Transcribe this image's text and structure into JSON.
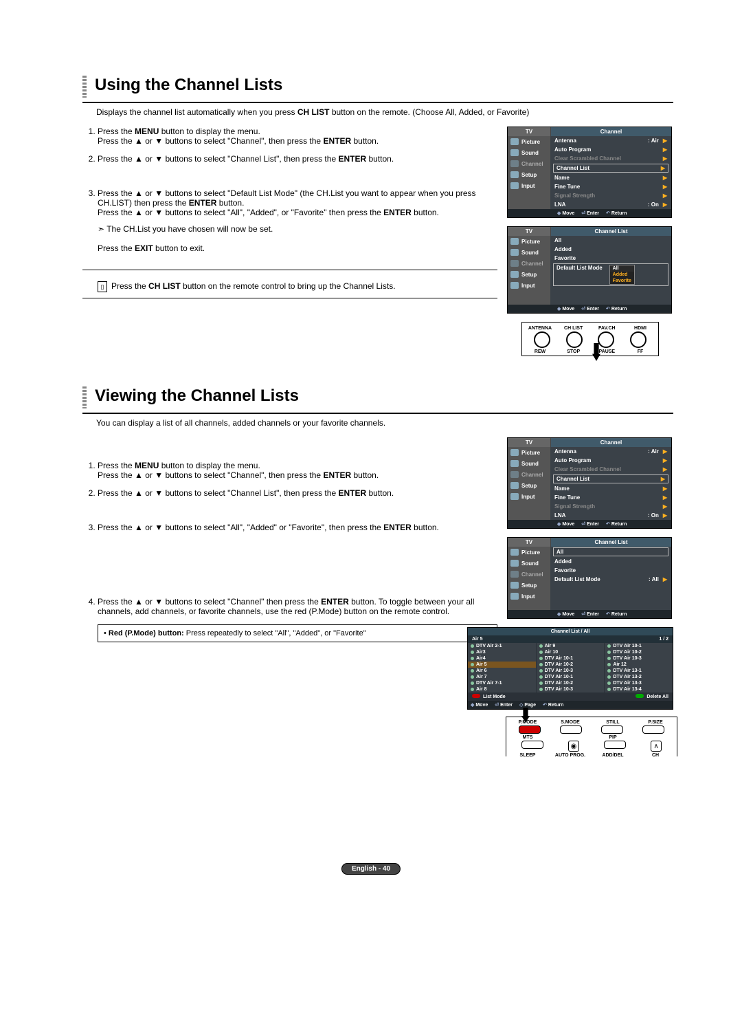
{
  "section1": {
    "title": "Using the Channel Lists",
    "intro_pre": "Displays the channel list automatically when you press ",
    "intro_key": "CH LIST",
    "intro_post": " button on the remote. (Choose All, Added, or Favorite)",
    "step1_a": "Press the ",
    "step1_key1": "MENU",
    "step1_b": " button to display the menu.",
    "step1_c": "Press the ▲ or ▼ buttons to select \"Channel\", then press the ",
    "step1_key2": "ENTER",
    "step1_d": " button.",
    "step2_a": "Press the ▲ or ▼ buttons to select \"Channel List\", then press the ",
    "step2_key": "ENTER",
    "step2_b": " button.",
    "step3_a": "Press the ▲ or ▼ buttons to select \"Default List Mode\" (the CH.List you want to appear when you press CH.LIST) then press the ",
    "step3_key1": "ENTER",
    "step3_b": " button.",
    "step3_c": "Press the ▲ or ▼ buttons to select \"All\", \"Added\", or \"Favorite\" then press the ",
    "step3_key2": "ENTER",
    "step3_d": " button.",
    "step3_note_icon": "➣",
    "step3_note": "The CH.List you have chosen will now be set.",
    "step3_exit_a": "Press the ",
    "step3_exit_key": "EXIT",
    "step3_exit_b": " button to exit.",
    "remote_note_a": "Press the ",
    "remote_note_key": "CH LIST",
    "remote_note_b": " button on the remote control to bring up the Channel Lists."
  },
  "section2": {
    "title": "Viewing the Channel Lists",
    "intro": "You can display a list of all channels, added channels or your favorite channels.",
    "step1_a": "Press the ",
    "step1_key1": "MENU",
    "step1_b": " button to display the menu.",
    "step1_c": "Press the ▲ or ▼ buttons to select \"Channel\", then press the ",
    "step1_key2": "ENTER",
    "step1_d": " button.",
    "step2_a": "Press the ▲ or ▼ buttons to select \"Channel List\", then press the ",
    "step2_key": "ENTER",
    "step2_b": " button.",
    "step3_a": "Press the ▲ or ▼ buttons to select \"All\", \"Added\" or \"Favorite\", then press the ",
    "step3_key": "ENTER",
    "step3_b": " button.",
    "step4_a": "Press the ▲ or ▼ buttons to select \"Channel\" then press the ",
    "step4_key": "ENTER",
    "step4_b": " button. To toggle between your all channels, add channels, or favorite channels, use the red (P.Mode) button on the remote control.",
    "callout_bullet": "•",
    "callout_key": "Red (P.Mode) button:",
    "callout_text": " Press repeatedly to select \"All\", \"Added\", or \"Favorite\""
  },
  "osd": {
    "tv": "TV",
    "channel_title": "Channel",
    "channel_list_title": "Channel List",
    "side": {
      "picture": "Picture",
      "sound": "Sound",
      "channel": "Channel",
      "setup": "Setup",
      "input": "Input"
    },
    "rows": {
      "antenna": "Antenna",
      "antenna_val": ": Air",
      "auto_program": "Auto Program",
      "clear_scrambled": "Clear Scrambled Channel",
      "channel_list": "Channel List",
      "name": "Name",
      "fine_tune": "Fine Tune",
      "signal_strength": "Signal Strength",
      "lna": "LNA",
      "lna_val": ": On",
      "all": "All",
      "added": "Added",
      "favorite": "Favorite",
      "default_list_mode": "Default List Mode",
      "dlm_val": ": All"
    },
    "dropdown": {
      "head": "All",
      "i1": "Added",
      "i2": "Favorite"
    },
    "foot": {
      "move": "Move",
      "enter": "Enter",
      "return": "Return"
    }
  },
  "remote_strip": {
    "top": [
      "ANTENNA",
      "CH LIST",
      "FAV.CH",
      "HDMI"
    ],
    "bottom": [
      "REW",
      "STOP",
      "PAUSE",
      "FF"
    ]
  },
  "ch_list": {
    "title": "Channel List / All",
    "selected": "Air 5",
    "page": "1 / 2",
    "col1": [
      "DTV Air 2-1",
      "Air3",
      "Air4",
      "Air 5",
      "Air 6",
      "Air 7",
      "DTV Air 7-1",
      "Air 8"
    ],
    "col2": [
      "Air 9",
      "Air 10",
      "DTV Air 10-1",
      "DTV Air 10-2",
      "DTV Air 10-3",
      "DTV Air 10-1",
      "DTV Air 10-2",
      "DTV Air 10-3"
    ],
    "col3": [
      "DTV Air 10-1",
      "DTV Air 10-2",
      "DTV Air 10-3",
      "Air 12",
      "DTV Air 13-1",
      "DTV Air 13-2",
      "DTV Air 13-3",
      "DTV Air 13-4"
    ],
    "btn_list_mode": "List Mode",
    "btn_delete_all": "Delete All",
    "foot": {
      "move": "Move",
      "enter": "Enter",
      "page": "Page",
      "return": "Return"
    }
  },
  "remote_block": {
    "row1": [
      "P.MODE",
      "S.MODE",
      "STILL",
      "P.SIZE"
    ],
    "row2": [
      "MTS",
      "",
      "PIP",
      ""
    ],
    "row3": [
      "SLEEP",
      "AUTO PROG.",
      "ADD/DEL",
      "CH"
    ]
  },
  "footer": "English - 40"
}
